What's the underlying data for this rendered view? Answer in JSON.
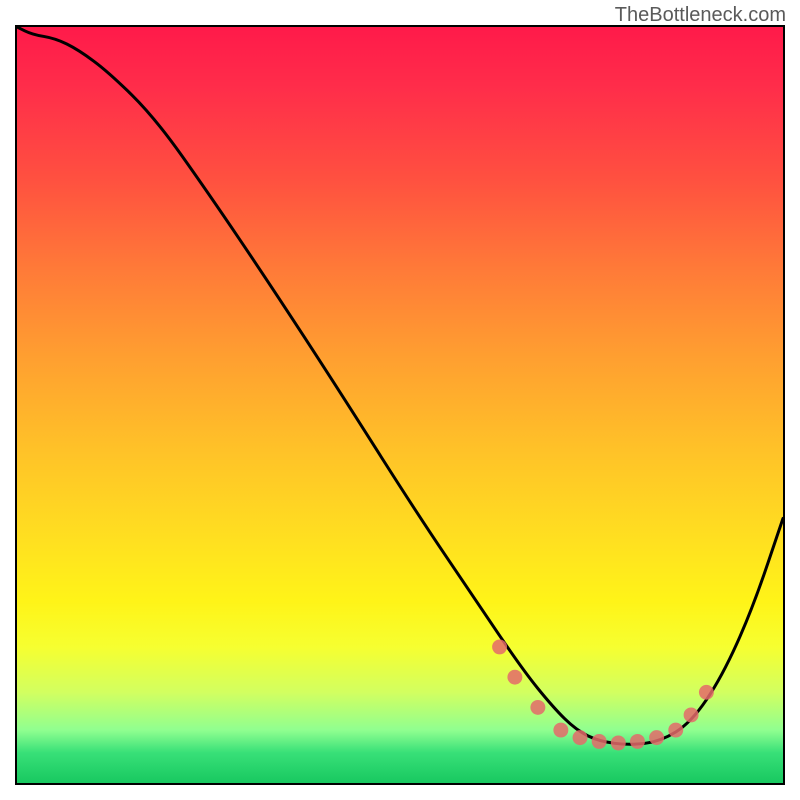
{
  "watermark": "TheBottleneck.com",
  "chart_data": {
    "type": "line",
    "title": "",
    "xlabel": "",
    "ylabel": "",
    "xlim": [
      0,
      100
    ],
    "ylim": [
      0,
      100
    ],
    "series": [
      {
        "name": "curve",
        "x": [
          0,
          2,
          5,
          8,
          12,
          18,
          25,
          33,
          42,
          52,
          60,
          66,
          70,
          73,
          76,
          80,
          84,
          88,
          92,
          96,
          100
        ],
        "y": [
          100,
          99,
          98.5,
          97,
          94,
          88,
          78,
          66,
          52,
          36,
          24,
          15,
          10,
          7,
          5.5,
          5,
          5.5,
          8,
          14,
          23,
          35
        ]
      }
    ],
    "markers": {
      "name": "dots",
      "x": [
        63,
        65,
        68,
        71,
        73.5,
        76,
        78.5,
        81,
        83.5,
        86,
        88,
        90
      ],
      "y": [
        18,
        14,
        10,
        7,
        6,
        5.5,
        5.3,
        5.5,
        6,
        7,
        9,
        12
      ]
    },
    "background_gradient": {
      "top_color": "#ff1a4a",
      "bottom_color": "#18c860",
      "description": "vertical red-to-green gradient indicating bottleneck severity"
    }
  }
}
